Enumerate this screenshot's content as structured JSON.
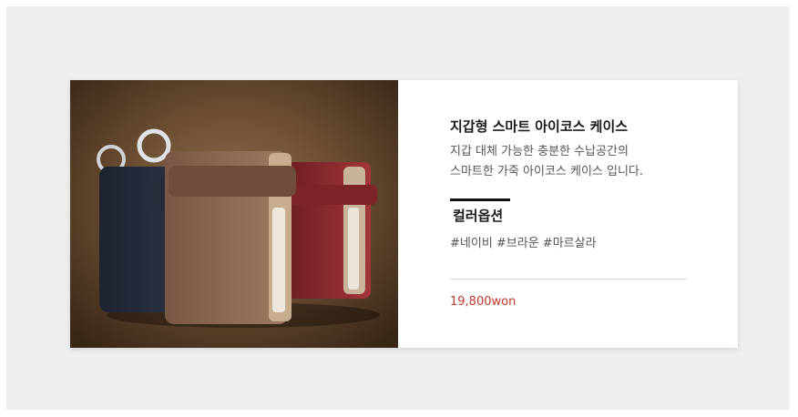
{
  "product": {
    "image_alt": "product-photo",
    "title": "지갑형 스마트 아이코스 케이스",
    "description": [
      "지갑 대체 가능한 충분한 수납공간의",
      "스마트한 가죽 아이코스 케이스 입니다."
    ],
    "options_title": "컬러옵션",
    "options_values": "#네이비 #브라운 #마르살라",
    "price": "19,800won"
  },
  "colors": {
    "background": "#efefef",
    "card": "#ffffff",
    "price": "#c0392b",
    "navy": "#2b3242",
    "brown": "#8b6550",
    "marsala": "#8e2b2e"
  }
}
